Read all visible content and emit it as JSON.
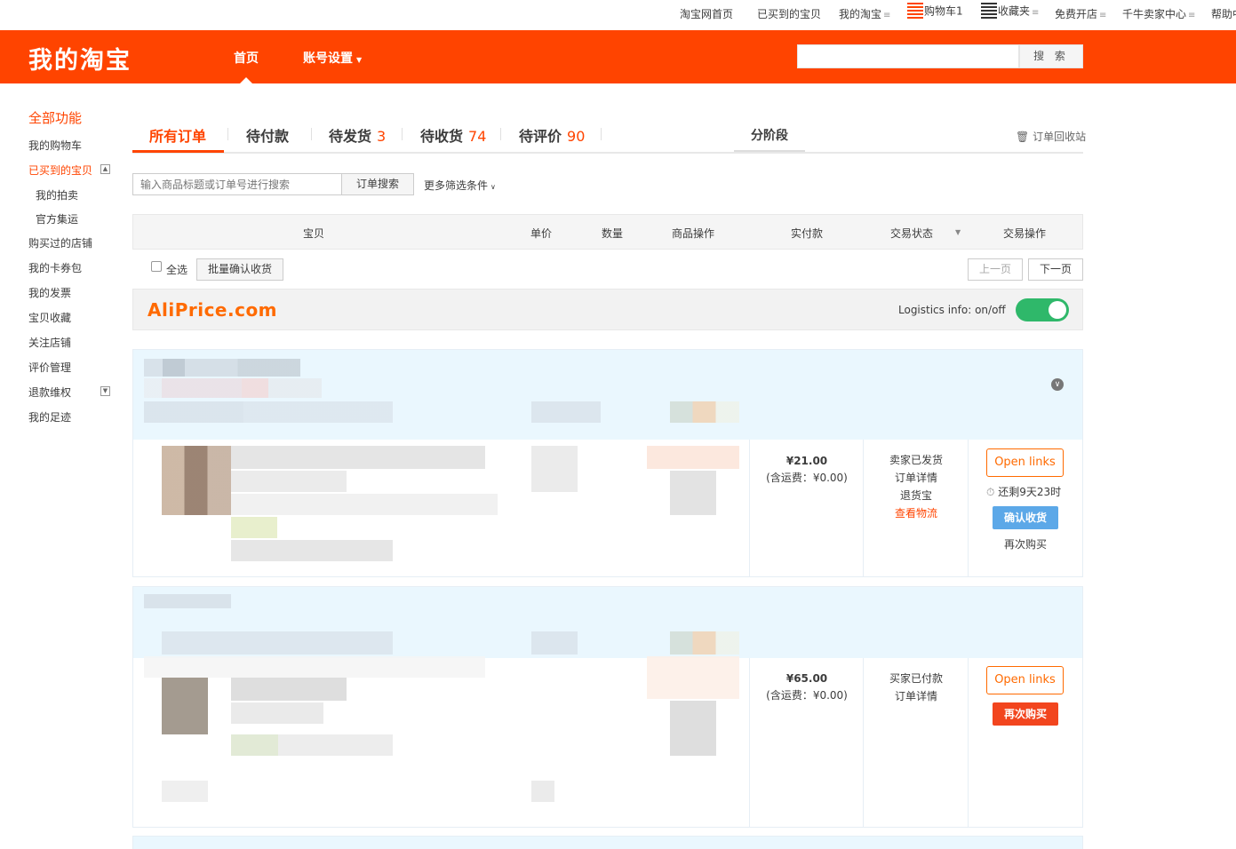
{
  "topnav": {
    "home": "淘宝网首页",
    "bought": "已买到的宝贝",
    "my_taobao": "我的淘宝",
    "cart": "购物车1",
    "favorites": "收藏夹",
    "open_shop": "免费开店",
    "seller_center": "千牛卖家中心",
    "help": "帮助中"
  },
  "header": {
    "logo": "我的淘宝",
    "nav_home": "首页",
    "nav_account": "账号设置",
    "search_button": "搜 索",
    "search_placeholder": ""
  },
  "sidebar": {
    "title": "全部功能",
    "items": [
      "我的购物车",
      "已买到的宝贝",
      "我的拍卖",
      "官方集运",
      "购买过的店铺",
      "我的卡券包",
      "我的发票",
      "宝贝收藏",
      "关注店铺",
      "评价管理",
      "退款维权",
      "我的足迹"
    ]
  },
  "tabs": {
    "all": "所有订单",
    "to_pay": "待付款",
    "to_ship": "待发货",
    "to_ship_count": "3",
    "to_receive": "待收货",
    "to_receive_count": "74",
    "to_review": "待评价",
    "to_review_count": "90",
    "phased": "分阶段",
    "recycle": "订单回收站"
  },
  "search": {
    "placeholder": "输入商品标题或订单号进行搜索",
    "button": "订单搜索",
    "more_filters": "更多筛选条件"
  },
  "table_header": [
    "宝贝",
    "单价",
    "数量",
    "商品操作",
    "实付款",
    "交易状态",
    "交易操作"
  ],
  "select_row": {
    "select_all": "全选",
    "batch_confirm": "批量确认收货",
    "prev_page": "上一页",
    "next_page": "下一页"
  },
  "aliprice": {
    "logo": "AliPrice.com",
    "logistics_label": "Logistics info: on/off",
    "toggle_on": true
  },
  "orders": [
    {
      "price": "¥21.00",
      "shipping": "(含运费：¥0.00)",
      "status_lines": [
        "卖家已发货",
        "订单详情",
        "退货宝"
      ],
      "status_link": "查看物流",
      "open_links": "Open links",
      "timer": "还剩9天23时",
      "confirm": "确认收货",
      "rebuy": "再次购买"
    },
    {
      "price": "¥65.00",
      "shipping": "(含运费：¥0.00)",
      "status_lines": [
        "买家已付款",
        "订单详情"
      ],
      "open_links": "Open links",
      "rebuy_button": "再次购买"
    }
  ],
  "colors": {
    "brand_orange": "#ff4400",
    "toggle_green": "#2fb86a",
    "confirm_blue": "#5ca8e8",
    "order_head_bg": "#eaf7fe"
  }
}
